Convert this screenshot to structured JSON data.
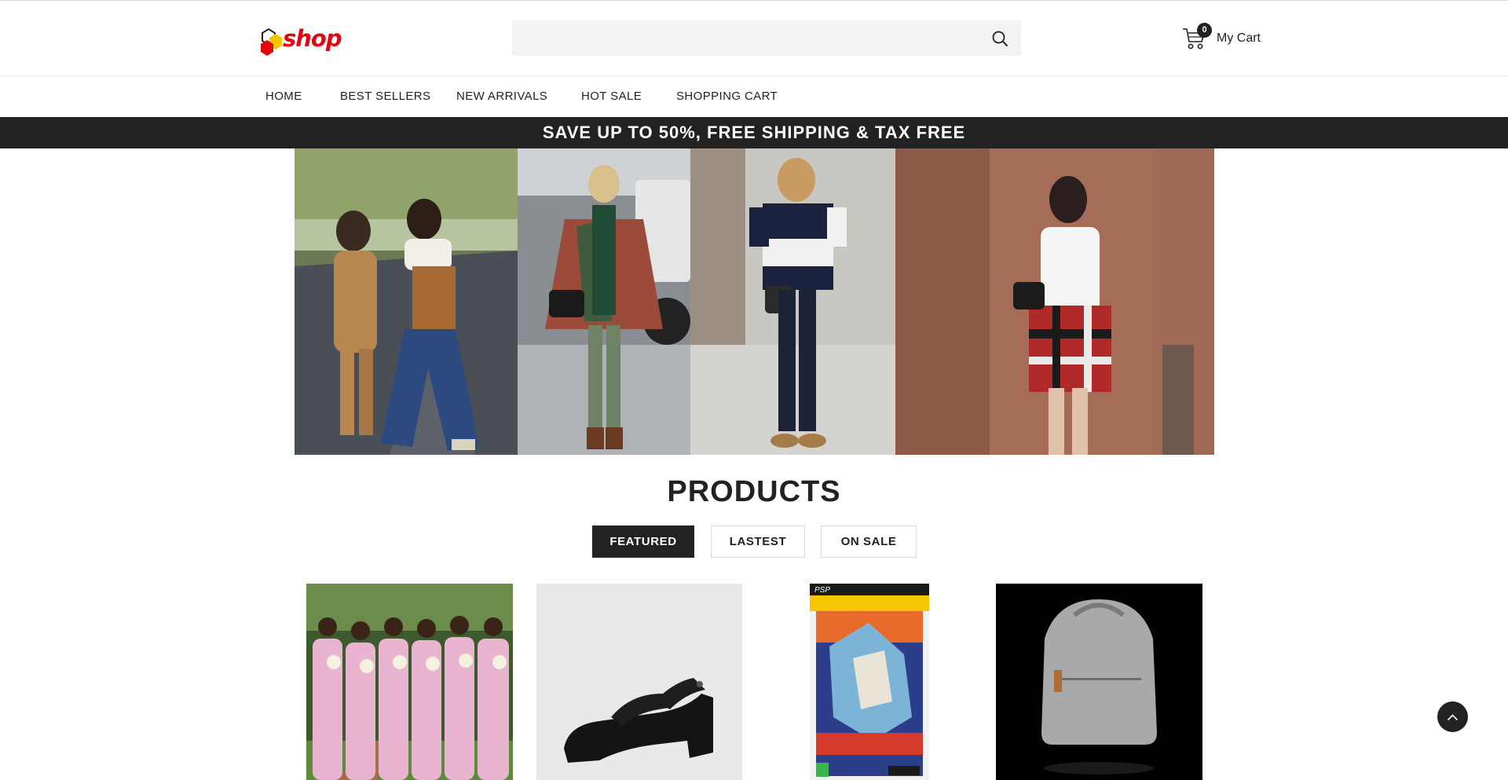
{
  "header": {
    "logo_text": "shop",
    "search": {
      "placeholder": "",
      "value": ""
    },
    "cart": {
      "count": "0",
      "label": "My Cart"
    }
  },
  "nav": {
    "items": [
      "HOME",
      "BEST SELLERS",
      "NEW ARRIVALS",
      "HOT SALE",
      "SHOPPING CART"
    ]
  },
  "promo": {
    "text": "SAVE UP TO 50%, FREE SHIPPING & TAX FREE"
  },
  "products_section": {
    "title": "PRODUCTS",
    "tabs": [
      {
        "label": "FEATURED",
        "active": true
      },
      {
        "label": "LASTEST",
        "active": false
      },
      {
        "label": "ON SALE",
        "active": false
      }
    ]
  },
  "colors": {
    "brand_red": "#e10610",
    "logo_yellow": "#f6c500",
    "dark": "#222222",
    "search_bg": "#f3f3f3"
  },
  "icons": {
    "search": "search-icon",
    "cart": "cart-icon",
    "back_to_top": "chevron-up-icon"
  }
}
